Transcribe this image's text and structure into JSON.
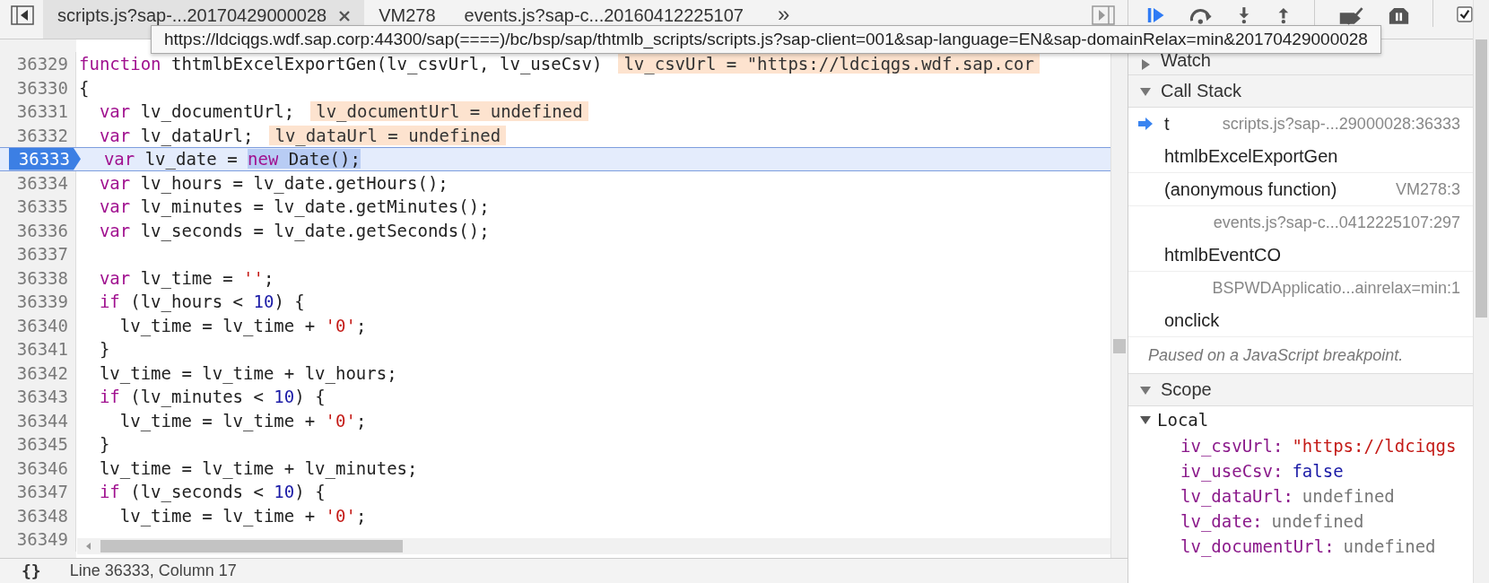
{
  "tabs": [
    {
      "label": "scripts.js?sap-...20170429000028",
      "selected": true,
      "closable": true
    },
    {
      "label": "VM278",
      "selected": false,
      "closable": false
    },
    {
      "label": "events.js?sap-c...20160412225107",
      "selected": false,
      "closable": false
    }
  ],
  "more_tabs": "»",
  "tooltip": "https://ldciqgs.wdf.sap.corp:44300/sap(====)/bc/bsp/sap/thtmlb_scripts/scripts.js?sap-client=001&sap-language=EN&sap-domainRelax=min&20170429000028",
  "debugger_toolbar": {
    "async_checkbox": {
      "checked": true
    }
  },
  "editor": {
    "lines": [
      {
        "number": "36329",
        "current": false,
        "tokens": [
          {
            "text": "function",
            "kind": "keyword"
          },
          {
            "text": " thtmlbExcelExportGen(lv_csvUrl, lv_useCsv)",
            "kind": "plain"
          }
        ],
        "annotation": "lv_csvUrl = \"https://ldciqgs.wdf.sap.cor"
      },
      {
        "number": "36330",
        "current": false,
        "tokens": [
          {
            "text": "{",
            "kind": "plain"
          }
        ]
      },
      {
        "number": "36331",
        "current": false,
        "tokens": [
          {
            "text": "  var",
            "kind": "keyword"
          },
          {
            "text": " lv_documentUrl;",
            "kind": "plain"
          }
        ],
        "annotation": "lv_documentUrl = undefined"
      },
      {
        "number": "36332",
        "current": false,
        "tokens": [
          {
            "text": "  var",
            "kind": "keyword"
          },
          {
            "text": " lv_dataUrl;",
            "kind": "plain"
          }
        ],
        "annotation": "lv_dataUrl = undefined"
      },
      {
        "number": "36333",
        "current": true,
        "tokens": [
          {
            "text": "  var",
            "kind": "keyword"
          },
          {
            "text": " lv_date = ",
            "kind": "plain"
          },
          {
            "text": "new",
            "kind": "keyword",
            "selected": true
          },
          {
            "text": " Date();",
            "kind": "plain",
            "selected": true
          }
        ]
      },
      {
        "number": "36334",
        "current": false,
        "tokens": [
          {
            "text": "  var",
            "kind": "keyword"
          },
          {
            "text": " lv_hours = lv_date.getHours();",
            "kind": "plain"
          }
        ]
      },
      {
        "number": "36335",
        "current": false,
        "tokens": [
          {
            "text": "  var",
            "kind": "keyword"
          },
          {
            "text": " lv_minutes = lv_date.getMinutes();",
            "kind": "plain"
          }
        ]
      },
      {
        "number": "36336",
        "current": false,
        "tokens": [
          {
            "text": "  var",
            "kind": "keyword"
          },
          {
            "text": " lv_seconds = lv_date.getSeconds();",
            "kind": "plain"
          }
        ]
      },
      {
        "number": "36337",
        "current": false
      },
      {
        "number": "36338",
        "current": false,
        "tokens": [
          {
            "text": "  var",
            "kind": "keyword"
          },
          {
            "text": " lv_time = ",
            "kind": "plain"
          },
          {
            "text": "''",
            "kind": "string"
          },
          {
            "text": ";",
            "kind": "plain"
          }
        ]
      },
      {
        "number": "36339",
        "current": false,
        "tokens": [
          {
            "text": "  if",
            "kind": "keyword"
          },
          {
            "text": " (lv_hours < ",
            "kind": "plain"
          },
          {
            "text": "10",
            "kind": "number"
          },
          {
            "text": ") {",
            "kind": "plain"
          }
        ]
      },
      {
        "number": "36340",
        "current": false,
        "tokens": [
          {
            "text": "    lv_time = lv_time + ",
            "kind": "plain"
          },
          {
            "text": "'0'",
            "kind": "string"
          },
          {
            "text": ";",
            "kind": "plain"
          }
        ]
      },
      {
        "number": "36341",
        "current": false,
        "tokens": [
          {
            "text": "  }",
            "kind": "plain"
          }
        ]
      },
      {
        "number": "36342",
        "current": false,
        "tokens": [
          {
            "text": "  lv_time = lv_time + lv_hours;",
            "kind": "plain"
          }
        ]
      },
      {
        "number": "36343",
        "current": false,
        "tokens": [
          {
            "text": "  if",
            "kind": "keyword"
          },
          {
            "text": " (lv_minutes < ",
            "kind": "plain"
          },
          {
            "text": "10",
            "kind": "number"
          },
          {
            "text": ") {",
            "kind": "plain"
          }
        ]
      },
      {
        "number": "36344",
        "current": false,
        "tokens": [
          {
            "text": "    lv_time = lv_time + ",
            "kind": "plain"
          },
          {
            "text": "'0'",
            "kind": "string"
          },
          {
            "text": ";",
            "kind": "plain"
          }
        ]
      },
      {
        "number": "36345",
        "current": false,
        "tokens": [
          {
            "text": "  }",
            "kind": "plain"
          }
        ]
      },
      {
        "number": "36346",
        "current": false,
        "tokens": [
          {
            "text": "  lv_time = lv_time + lv_minutes;",
            "kind": "plain"
          }
        ]
      },
      {
        "number": "36347",
        "current": false,
        "tokens": [
          {
            "text": "  if",
            "kind": "keyword"
          },
          {
            "text": " (lv_seconds < ",
            "kind": "plain"
          },
          {
            "text": "10",
            "kind": "number"
          },
          {
            "text": ") {",
            "kind": "plain"
          }
        ]
      },
      {
        "number": "36348",
        "current": false,
        "tokens": [
          {
            "text": "    lv_time = lv_time + ",
            "kind": "plain"
          },
          {
            "text": "'0'",
            "kind": "string"
          },
          {
            "text": ";",
            "kind": "plain"
          }
        ]
      },
      {
        "number": "36349",
        "current": false
      }
    ]
  },
  "status_bar": {
    "pretty_print": "{}",
    "position": "Line 36333, Column 17"
  },
  "watch": {
    "label": "Watch",
    "expanded": false
  },
  "call_stack": {
    "label": "Call Stack",
    "expanded": true,
    "frames": [
      {
        "current": true,
        "lines": [
          {
            "name": "t",
            "location": "scripts.js?sap-...29000028:36333"
          },
          {
            "name": "htmlbExcelExportGen"
          }
        ]
      },
      {
        "current": false,
        "lines": [
          {
            "name": "(anonymous function)",
            "location": "VM278:3"
          }
        ]
      },
      {
        "current": false,
        "lines": [
          {
            "location": "events.js?sap-c...0412225107:297"
          },
          {
            "name": "htmlbEventCO"
          }
        ]
      },
      {
        "current": false,
        "lines": [
          {
            "location": "BSPWDApplicatio...ainrelax=min:1"
          },
          {
            "name": "onclick"
          }
        ]
      }
    ]
  },
  "paused_message": "Paused on a JavaScript breakpoint.",
  "scope": {
    "label": "Scope",
    "expanded": true,
    "local": {
      "label": "Local",
      "expanded": true,
      "properties": [
        {
          "name": "iv_csvUrl:",
          "value": "\"https://ldciqgs",
          "kind": "string"
        },
        {
          "name": "iv_useCsv:",
          "value": "false",
          "kind": "boolean"
        },
        {
          "name": "lv_dataUrl:",
          "value": "undefined",
          "kind": "undefined"
        },
        {
          "name": "lv_date:",
          "value": "undefined",
          "kind": "undefined"
        },
        {
          "name": "lv_documentUrl:",
          "value": "undefined",
          "kind": "undefined"
        }
      ]
    }
  }
}
